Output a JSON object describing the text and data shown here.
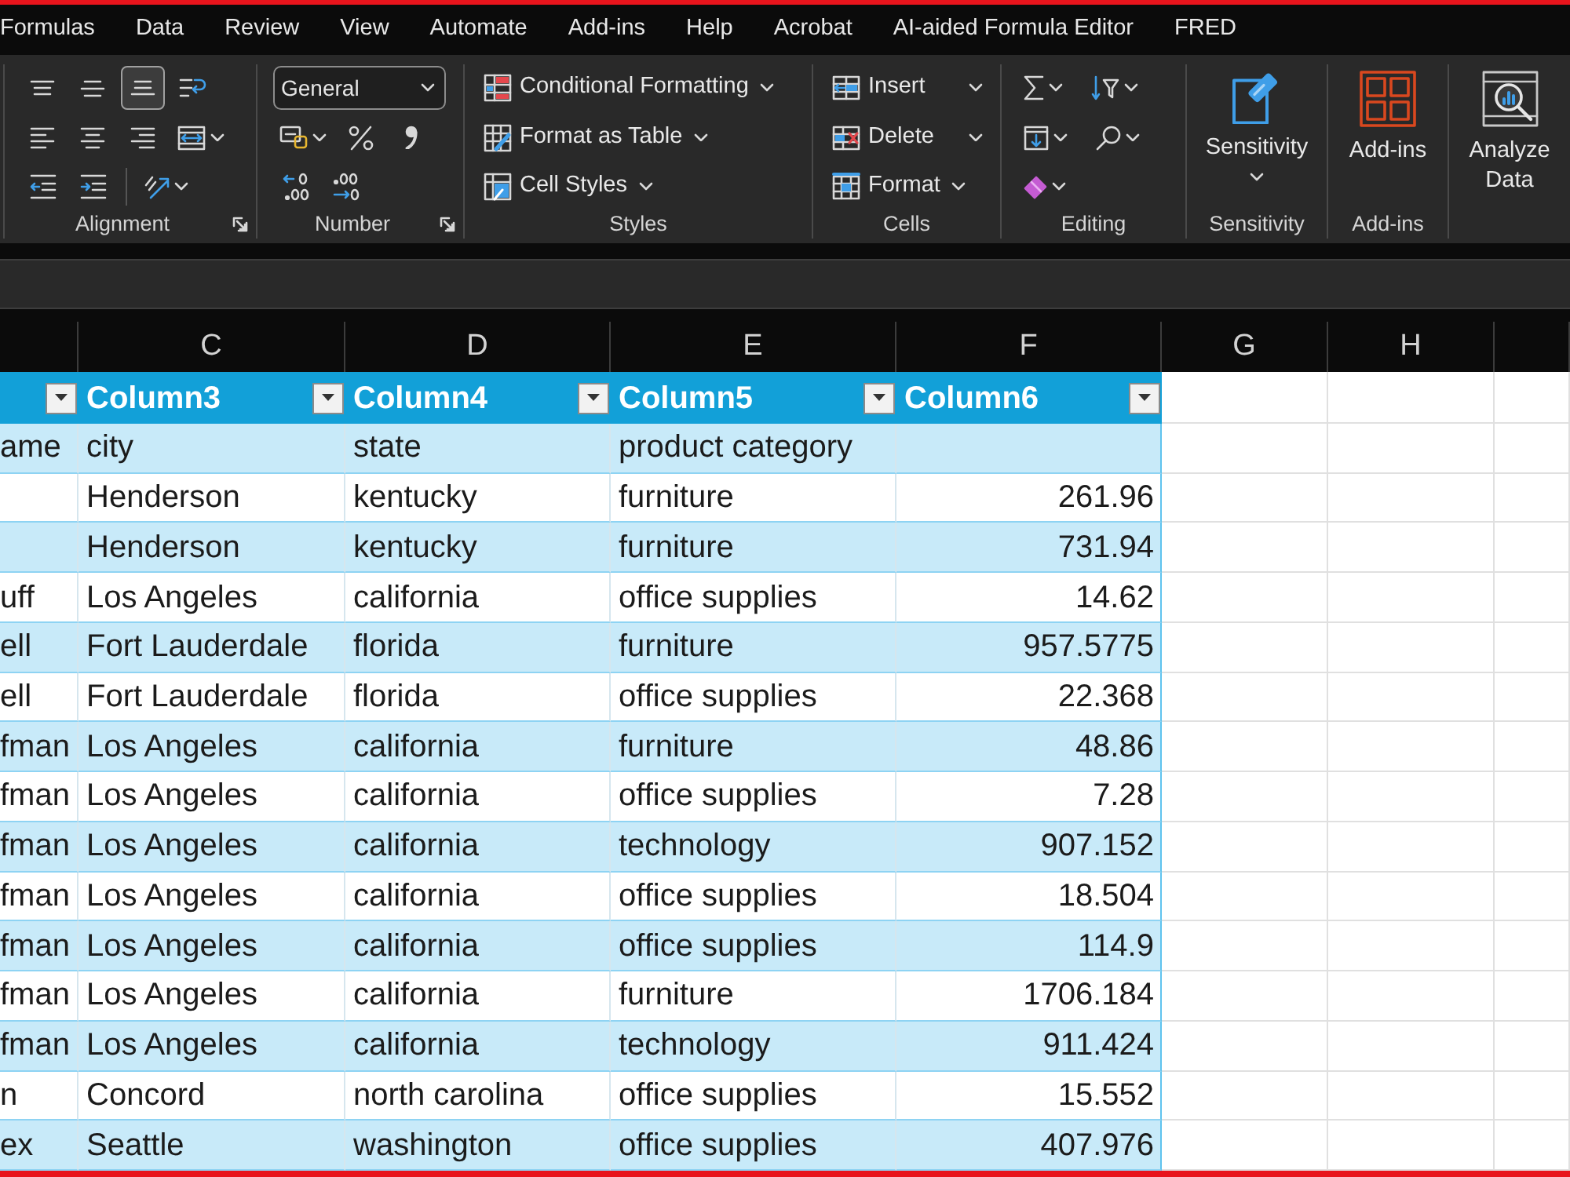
{
  "menu_tabs": [
    "Formulas",
    "Data",
    "Review",
    "View",
    "Automate",
    "Add-ins",
    "Help",
    "Acrobat",
    "AI-aided Formula Editor",
    "FRED"
  ],
  "ribbon_groups": [
    {
      "kind": "grid",
      "label": "Alignment",
      "launcher": true,
      "rows": [
        [
          {
            "kind": "top",
            "selected": false
          },
          {
            "kind": "middle",
            "selected": false
          },
          {
            "kind": "bottom",
            "selected": true
          },
          {
            "kind": "wrap",
            "selected": false
          }
        ],
        [
          {
            "kind": "left",
            "selected": false
          },
          {
            "kind": "center",
            "selected": false
          },
          {
            "kind": "right",
            "selected": false
          },
          {
            "kind": "merge",
            "selected": false,
            "dropdown": true
          }
        ],
        [
          {
            "kind": "outdent",
            "selected": false
          },
          {
            "kind": "indent",
            "selected": false
          },
          {
            "kind": "orientation",
            "selected": false,
            "dropdown": true
          }
        ]
      ]
    },
    {
      "kind": "number",
      "label": "Number",
      "launcher": true,
      "format": "General",
      "rows": [
        [
          {
            "kind": "accounting",
            "dropdown": true
          },
          {
            "kind": "percent"
          },
          {
            "kind": "comma"
          }
        ],
        [
          {
            "kind": "moredecimals"
          },
          {
            "kind": "fewerdecimals"
          }
        ]
      ]
    },
    {
      "kind": "list",
      "label": "Styles",
      "items": [
        {
          "kind": "conditional",
          "text": "Conditional Formatting",
          "dropdown": true
        },
        {
          "kind": "table",
          "text": "Format as Table",
          "dropdown": true
        },
        {
          "kind": "styles",
          "text": "Cell Styles",
          "dropdown": true
        }
      ]
    },
    {
      "kind": "list",
      "label": "Cells",
      "items": [
        {
          "kind": "insert",
          "text": "Insert",
          "dropdown": true,
          "split": true
        },
        {
          "kind": "delete",
          "text": "Delete",
          "dropdown": true,
          "split": true
        },
        {
          "kind": "format",
          "text": "Format",
          "dropdown": true
        }
      ]
    },
    {
      "kind": "grid",
      "label": "Editing",
      "rows": [
        [
          {
            "kind": "sum",
            "dropdown": true
          },
          {
            "kind": "sort",
            "dropdown": true
          }
        ],
        [
          {
            "kind": "fill",
            "dropdown": true
          },
          {
            "kind": "find",
            "dropdown": true
          }
        ],
        [
          {
            "kind": "clear",
            "dropdown": true
          }
        ]
      ]
    },
    {
      "kind": "large",
      "label": "Sensitivity",
      "items": [
        {
          "kind": "sensitivity",
          "text": "Sensitivity",
          "dropdown": true
        }
      ]
    },
    {
      "kind": "large",
      "label": "Add-ins",
      "items": [
        {
          "kind": "addins",
          "text": "Add-ins"
        }
      ]
    },
    {
      "kind": "large",
      "items": [
        {
          "kind": "analyze",
          "text": "Analyze Data"
        }
      ]
    }
  ],
  "sheet": {
    "column_letters": [
      "C",
      "D",
      "E",
      "F",
      "G",
      "H"
    ]
  },
  "table": {
    "columns": [
      {
        "filter": true
      },
      {
        "label": "Column3",
        "filter": true
      },
      {
        "label": "Column4",
        "filter": true
      },
      {
        "label": "Column5",
        "filter": true
      },
      {
        "label": "Column6",
        "filter": true
      }
    ],
    "rows": [
      [
        "ame",
        "city",
        "state",
        "product category",
        null
      ],
      [
        null,
        "Henderson",
        "kentucky",
        "furniture",
        "261.96"
      ],
      [
        null,
        "Henderson",
        "kentucky",
        "furniture",
        "731.94"
      ],
      [
        "uff",
        "Los Angeles",
        "california",
        "office supplies",
        "14.62"
      ],
      [
        "ell",
        "Fort Lauderdale",
        "florida",
        "furniture",
        "957.5775"
      ],
      [
        "ell",
        "Fort Lauderdale",
        "florida",
        "office supplies",
        "22.368"
      ],
      [
        "fman",
        "Los Angeles",
        "california",
        "furniture",
        "48.86"
      ],
      [
        "fman",
        "Los Angeles",
        "california",
        "office supplies",
        "7.28"
      ],
      [
        "fman",
        "Los Angeles",
        "california",
        "technology",
        "907.152"
      ],
      [
        "fman",
        "Los Angeles",
        "california",
        "office supplies",
        "18.504"
      ],
      [
        "fman",
        "Los Angeles",
        "california",
        "office supplies",
        "114.9"
      ],
      [
        "fman",
        "Los Angeles",
        "california",
        "furniture",
        "1706.184"
      ],
      [
        "fman",
        "Los Angeles",
        "california",
        "technology",
        "911.424"
      ],
      [
        "n",
        "Concord",
        "north carolina",
        "office supplies",
        "15.552"
      ],
      [
        "ex",
        "Seattle",
        "washington",
        "office supplies",
        "407.976"
      ]
    ]
  }
}
